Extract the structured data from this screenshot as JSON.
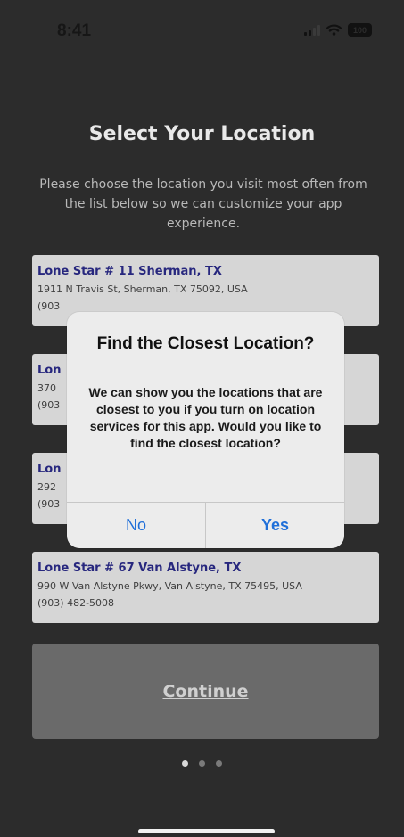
{
  "status_bar": {
    "time": "8:41",
    "battery": "100"
  },
  "title": "Select Your Location",
  "intro": "Please choose the location you visit most often from the list below so we can customize your app experience.",
  "locations": [
    {
      "name": "Lone Star # 11 Sherman, TX",
      "address": "1911 N Travis St, Sherman, TX 75092, USA",
      "phone": "(903"
    },
    {
      "name": "Lon",
      "address": "370",
      "phone": "(903"
    },
    {
      "name": "Lon",
      "address": "292",
      "phone": "(903"
    },
    {
      "name": "Lone Star # 67 Van Alstyne, TX",
      "address": "990 W Van Alstyne Pkwy, Van Alstyne, TX 75495, USA",
      "phone": "(903) 482-5008"
    }
  ],
  "alert": {
    "title": "Find the Closest Location?",
    "message": "We can show you the locations that are closest to you if you turn on location services for this app. Would you like to find the closest location?",
    "no_label": "No",
    "yes_label": "Yes"
  },
  "continue_label": "Continue",
  "page_indicator": {
    "count": 3,
    "active": 1
  },
  "colors": {
    "background": "#2c2c2c",
    "card": "#d6d6d6",
    "card_title": "#27277e",
    "alert_button": "#1f6fd9",
    "continue_button": "#6a6a6a"
  }
}
